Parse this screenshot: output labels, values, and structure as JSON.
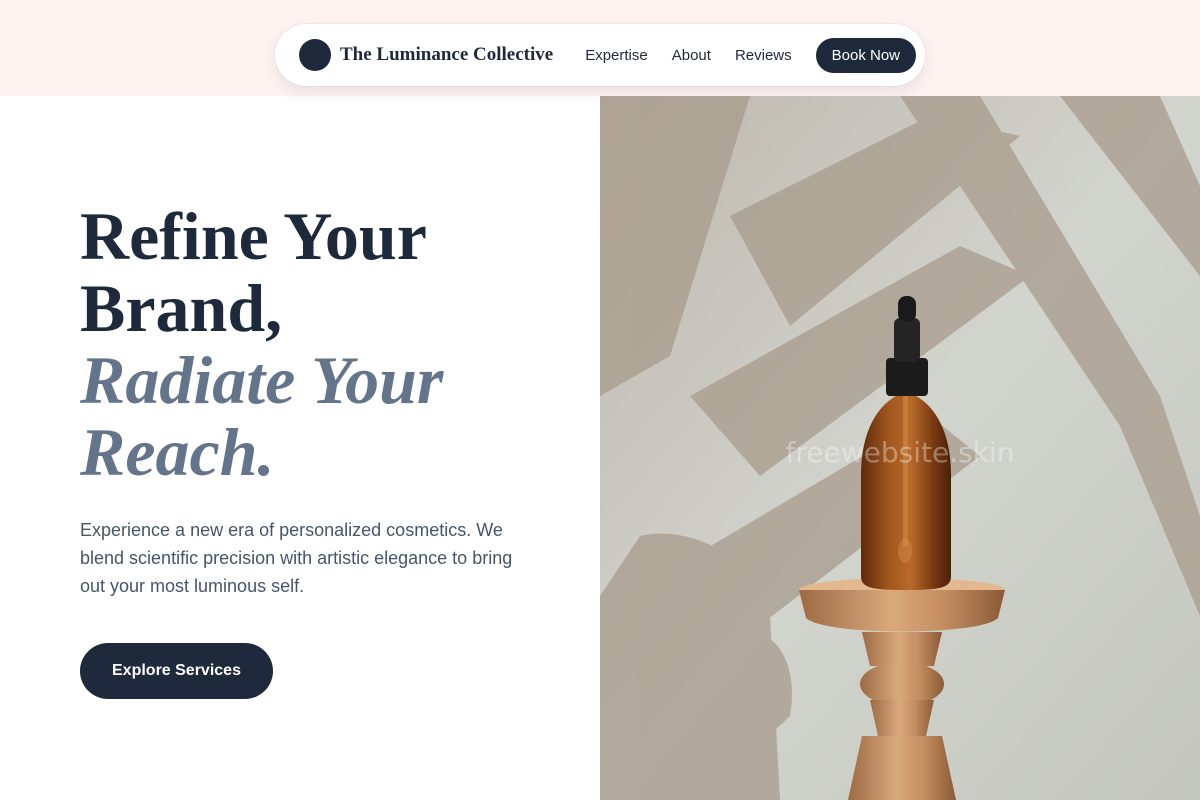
{
  "nav": {
    "brand": "The Luminance Collective",
    "links": [
      "Expertise",
      "About",
      "Reviews"
    ],
    "cta": "Book Now"
  },
  "hero": {
    "headline_line1": "Refine Your",
    "headline_line2": "Brand,",
    "headline_accent_line1": "Radiate Your",
    "headline_accent_line2": "Reach.",
    "description": "Experience a new era of personalized cosmetics. We blend scientific precision with artistic elegance to bring out your most luminous self.",
    "button": "Explore Services"
  },
  "image": {
    "watermark": "freewebsite.skin",
    "subject": "amber-dropper-bottle-on-wooden-pedestal"
  },
  "colors": {
    "navy": "#1e293b",
    "accent_slate": "#64748b",
    "top_band": "#fff4f2"
  }
}
